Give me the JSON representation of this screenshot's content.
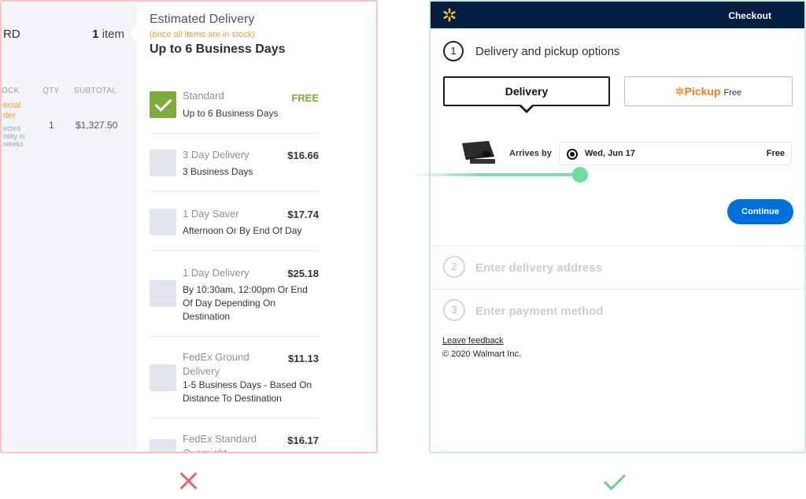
{
  "left_panel": {
    "cart": {
      "truncated_title": "RD",
      "item_count": "1",
      "item_word": "item",
      "columns": {
        "stock": "OCK",
        "qty": "QTY",
        "subtotal": "SUBTOTAL"
      },
      "row": {
        "status_line1": "ecial",
        "status_line2": "der",
        "note_line1": "ected",
        "note_line2": "bility in",
        "note_line3": "weeks",
        "qty": "1",
        "subtotal": "$1,327.50"
      }
    },
    "estimated_delivery": {
      "title": "Estimated Delivery",
      "note": "(once all items are in stock)",
      "days": "Up to 6 Business Days"
    },
    "options": [
      {
        "name": "Standard",
        "desc": "Up to 6 Business Days",
        "price": "FREE",
        "checked": true
      },
      {
        "name": "3 Day Delivery",
        "desc": "3 Business Days",
        "price": "$16.66"
      },
      {
        "name": "1 Day Saver",
        "desc": "Afternoon Or By End Of Day",
        "price": "$17.74"
      },
      {
        "name": "1 Day Delivery",
        "desc": "By 10:30am, 12:00pm Or End Of Day Depending On Destination",
        "price": "$25.18"
      },
      {
        "name": "FedEx Ground Delivery",
        "desc": "1-5 Business Days - Based On Distance To Destination",
        "price": "$11.13"
      },
      {
        "name": "FedEx Standard Overnight",
        "desc": "",
        "price": "$16.17"
      }
    ],
    "colors": {
      "border": "#f7c5c5",
      "accent": "#f59a3a",
      "check_green": "#7cac3e"
    }
  },
  "right_panel": {
    "header": {
      "title": "Checkout",
      "logo": "walmart-spark-icon",
      "bar_color": "#041e42"
    },
    "step1": {
      "number": "1",
      "title": "Delivery and pickup options"
    },
    "tabs": {
      "delivery": "Delivery",
      "pickup": "Pickup",
      "pickup_free": "Free"
    },
    "delivery_row": {
      "arrives_label": "Arrives by",
      "date": "Wed, Jun 17",
      "price": "Free"
    },
    "continue": "Continue",
    "step2": {
      "number": "2",
      "title": "Enter delivery address"
    },
    "step3": {
      "number": "3",
      "title": "Enter payment method"
    },
    "feedback": "Leave feedback",
    "copyright": "© 2020 Walmart Inc.",
    "colors": {
      "border": "#c9ecd9",
      "button_blue": "#0071dc",
      "pickup_orange": "#f07a1a"
    }
  },
  "verdict": {
    "left": "cross-icon",
    "right": "checkmark-icon"
  }
}
